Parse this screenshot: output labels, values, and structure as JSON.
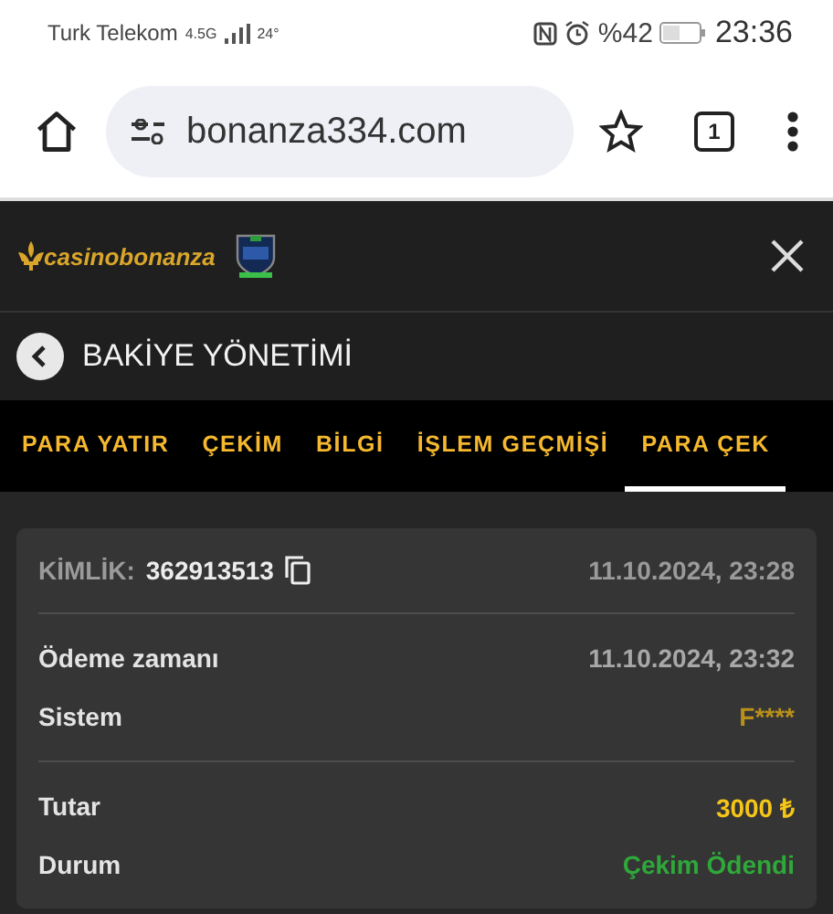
{
  "status_bar": {
    "carrier": "Turk Telekom",
    "network": "4.5G",
    "temperature": "24°",
    "battery": "%42",
    "time": "23:36"
  },
  "browser": {
    "url": "bonanza334.com",
    "tab_count": "1"
  },
  "site_header": {
    "logo": "casinobonanza"
  },
  "page_title": "BAKİYE YÖNETİMİ",
  "tabs": [
    {
      "label": "PARA YATIR",
      "selected": false
    },
    {
      "label": "ÇEKİM",
      "selected": false
    },
    {
      "label": "BİLGİ",
      "selected": false
    },
    {
      "label": "İŞLEM GEÇMİŞİ",
      "selected": false
    },
    {
      "label": "PARA ÇEK",
      "selected": true
    }
  ],
  "transaction": {
    "id_label": "KİMLİK:",
    "id_value": "362913513",
    "created": "11.10.2024, 23:28",
    "sections": [
      [
        {
          "label": "Ödeme zamanı",
          "value": "11.10.2024, 23:32",
          "kind": "plain"
        },
        {
          "label": "Sistem",
          "value": "F****",
          "kind": "masked"
        }
      ],
      [
        {
          "label": "Tutar",
          "value": "3000 ₺",
          "kind": "amount"
        },
        {
          "label": "Durum",
          "value": "Çekim Ödendi",
          "kind": "status"
        }
      ]
    ]
  }
}
